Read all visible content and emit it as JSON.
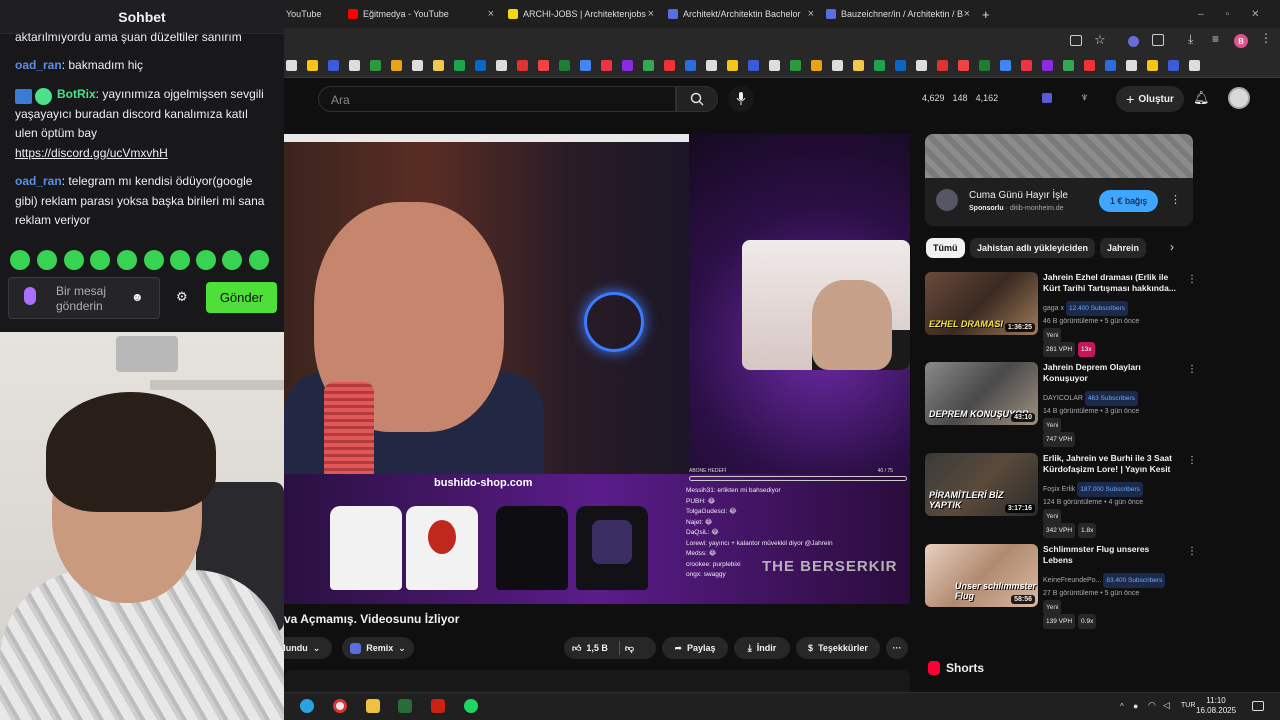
{
  "browser": {
    "tabs": [
      {
        "label": "YouTube",
        "color": "#ff0000"
      },
      {
        "label": "Eğitmedya - YouTube",
        "color": "#ff0000"
      },
      {
        "label": "ARCHI-JOBS | Architektenjobs",
        "color": "#f5d90a"
      },
      {
        "label": "Architekt/Architektin Bachelor",
        "color": "#5b6ee1"
      },
      {
        "label": "Bauzeichner/in / Architektin / B",
        "color": "#5b6ee1"
      }
    ],
    "new_tab": "+",
    "profile_initial": "B"
  },
  "youtube": {
    "search_placeholder": "Ara",
    "stats": {
      "a": "4,629",
      "b": "148",
      "c": "4,162"
    },
    "create_label": "Oluştur",
    "video_title": "va Açmamış. Videosunu İzliyor",
    "actions": {
      "joined": "olundu",
      "remix": "Remix",
      "likes": "1,5 B",
      "share": "Paylaş",
      "download": "İndir",
      "thanks": "Teşekkürler",
      "more": "···"
    },
    "in_video": {
      "shop": "bushido-shop.com",
      "goal": "ABONE HEDEFİ",
      "goal_count": "40 / 75",
      "berserk": "THE BERSERKIR",
      "chat": [
        "Messih31: erlikten mi bahsediyor",
        "PUBH: 😂",
        "TolgaGudesci: 😂",
        "Najet: 😂",
        "DaQsiL: 😂",
        "Lorewi: yayıncı + kalantor müvekkil diyor @Jahrein",
        "Medss: 😂",
        "crookee: purplebixi",
        "ongx: swaggy"
      ]
    },
    "ad": {
      "title": "Cuma Günü Hayır İşle",
      "sponsor": "Sponsorlu",
      "domain": "ditib-monheim.de",
      "button": "1 € bağış"
    },
    "chips": [
      "Tümü",
      "Jahistan adlı yükleyiciden",
      "Jahrein"
    ],
    "recommendations": [
      {
        "title": "Jahrein Ezhel draması (Erlik ile Kürt Tarihi Tartışması hakkında...",
        "channel": "gaga x",
        "subs": "12.400 Subscribers",
        "meta": "46 B görüntüleme • 5 gün önce",
        "new": "Yeni",
        "vph": "281 VPH",
        "mult": "13x",
        "duration": "1:36:25",
        "caption": "EZHEL DRAMASI"
      },
      {
        "title": "Jahrein Deprem Olayları Konuşuyor",
        "channel": "DAYICOLAR",
        "subs": "463 Subscribers",
        "meta": "14 B görüntüleme • 3 gün önce",
        "new": "Yeni",
        "vph": "747 VPH",
        "mult": "",
        "duration": "43:10",
        "caption": "DEPREM KONUŞUYOR"
      },
      {
        "title": "Erlik, Jahrein ve Burhi ile 3 Saat Kürdofaşizm Lore! | Yayın Kesit",
        "channel": "Foşix Erlik",
        "subs": "187.000 Subscribers",
        "meta": "124 B görüntüleme • 4 gün önce",
        "new": "Yeni",
        "vph": "342 VPH",
        "mult": "1.8x",
        "duration": "3:17:16",
        "caption": "PİRAMİTLERİ BİZ YAPTIK"
      },
      {
        "title": "Schlimmster Flug unseres Lebens",
        "channel": "KeineFreundePo...",
        "subs": "83.400 Subscribers",
        "meta": "27 B görüntüleme • 5 gün önce",
        "new": "Yeni",
        "vph": "139 VPH",
        "mult": "0.9x",
        "duration": "58:56",
        "caption": "Unser schlimmster Flug"
      }
    ],
    "shorts_label": "Shorts"
  },
  "stream_chat": {
    "header": "Sohbet",
    "messages": [
      {
        "user": "",
        "text": "aktarılmıyordu ama şuan düzeltiler sanırım"
      },
      {
        "user": "oad_ran",
        "text": ": bakmadım hiç"
      },
      {
        "user": "BotRix",
        "text": ": yayınımıza ojgelmişsen sevgili yaşayayıcı buradan discord kanalımıza katıl ulen öptüm bay"
      },
      {
        "link": "https://discord.gg/ucVmxvhH"
      },
      {
        "user": "oad_ran",
        "text": ": telegram mı kendisi ödüyor(google gibi) reklam parası yoksa başka birileri mi sana reklam veriyor"
      }
    ],
    "input_placeholder": "Bir mesaj gönderin",
    "send_label": "Gönder"
  },
  "taskbar": {
    "lang": "TUR",
    "time": "11:10",
    "date": "16.08.2025"
  }
}
